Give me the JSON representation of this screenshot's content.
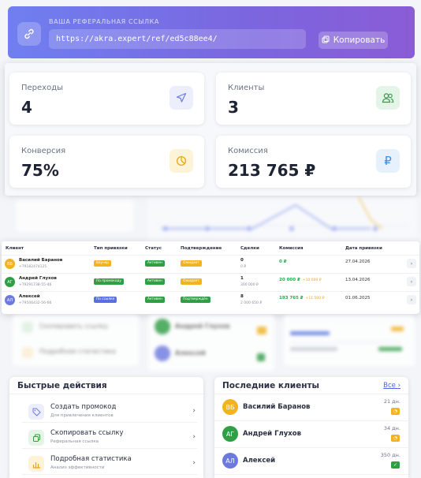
{
  "referral": {
    "label": "ВАША РЕФЕРАЛЬНАЯ ССЫЛКА",
    "url": "https://akra.expert/ref/ed5c88ee4/",
    "copy_label": "Копировать"
  },
  "stats": [
    {
      "label": "Переходы",
      "value": "4",
      "icon": "send-icon"
    },
    {
      "label": "Клиенты",
      "value": "3",
      "icon": "users-icon"
    },
    {
      "label": "Конверсия",
      "value": "75%",
      "icon": "pie-chart-icon"
    },
    {
      "label": "Комиссия",
      "value": "213 765 ₽",
      "icon": "ruble-icon"
    }
  ],
  "table": {
    "headers": [
      "Клиент",
      "Тип привязки",
      "Статус",
      "Подтверждение",
      "Сделки",
      "Комиссия",
      "Дата привязки"
    ],
    "rows": [
      {
        "initials": "ВБ",
        "name": "Василий Баранов",
        "phone": "+79182474125",
        "bind_type": "Ваучер",
        "status": "Активен",
        "confirm": "Ожидает",
        "deals": "0",
        "deals_sum": "0 ₽",
        "commission": "0 ₽",
        "commission_extra": "",
        "date": "27.04.2026"
      },
      {
        "initials": "АГ",
        "name": "Андрей Глухов",
        "phone": "+79291738-55-46",
        "bind_type": "По промокоду",
        "status": "Активен",
        "confirm": "Ожидает",
        "deals": "1",
        "deals_sum": "300 000 ₽",
        "commission": "20 000 ₽",
        "commission_extra": "+10 000 ₽",
        "date": "13.04.2026"
      },
      {
        "initials": "АЛ",
        "name": "Алексей",
        "phone": "+79506432-56-66",
        "bind_type": "По ссылке",
        "status": "Активен",
        "confirm": "Подтверждён",
        "deals": "8",
        "deals_sum": "2 000 650 ₽",
        "commission": "193 765 ₽",
        "commission_extra": "+11 500 ₽",
        "date": "01.06.2025"
      }
    ]
  },
  "quick_actions": {
    "title": "Быстрые действия",
    "items": [
      {
        "title": "Создать промокод",
        "subtitle": "Для привлечения клиентов",
        "icon": "tag-icon"
      },
      {
        "title": "Скопировать ссылку",
        "subtitle": "Реферальная ссылка",
        "icon": "copy-icon"
      },
      {
        "title": "Подробная статистика",
        "subtitle": "Анализ эффективности",
        "icon": "bar-chart-icon"
      }
    ]
  },
  "recent_clients": {
    "title": "Последние клиенты",
    "see_all": "Все",
    "items": [
      {
        "initials": "ВБ",
        "name": "Василий Баранов",
        "days": "21 дн.",
        "color": "#f2b320",
        "badge_color": "#f2b320"
      },
      {
        "initials": "АГ",
        "name": "Андрей Глухов",
        "days": "34 дн.",
        "color": "#2f9e44",
        "badge_color": "#f2b320"
      },
      {
        "initials": "АЛ",
        "name": "Алексей",
        "days": "350 дн.",
        "color": "#6c7ae0",
        "badge_color": "#2f9e44"
      }
    ]
  },
  "blurred_background": {
    "menu_items": [
      "Скопировать ссылку",
      "Подробная статистика"
    ],
    "clients": [
      "Андрей Глухов",
      "Алексей"
    ]
  },
  "colors": {
    "accent": "#6c7ae0",
    "green": "#2f9e44",
    "orange": "#f2b320",
    "blue_badge": "#5a6fe0"
  }
}
